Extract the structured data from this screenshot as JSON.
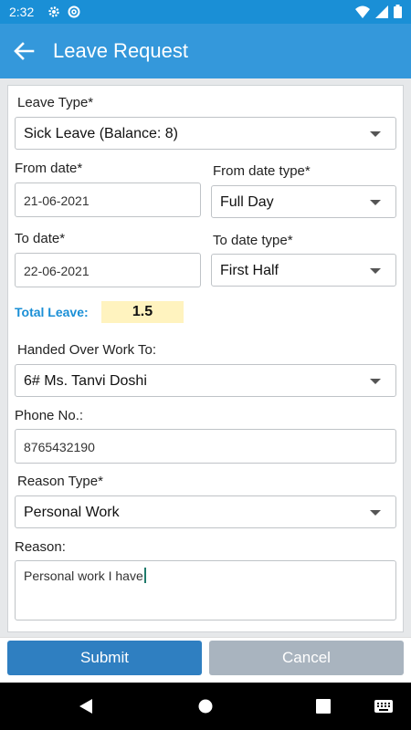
{
  "status_bar": {
    "time": "2:32"
  },
  "app_bar": {
    "title": "Leave Request"
  },
  "form": {
    "leave_type": {
      "label": "Leave Type*",
      "value": "Sick Leave (Balance: 8)"
    },
    "from_date": {
      "label": "From date*",
      "value": "21-06-2021"
    },
    "from_date_type": {
      "label": "From date type*",
      "value": "Full Day"
    },
    "to_date": {
      "label": "To date*",
      "value": "22-06-2021"
    },
    "to_date_type": {
      "label": "To date type*",
      "value": "First Half"
    },
    "total_leave": {
      "label": "Total Leave:",
      "value": "1.5"
    },
    "handed_over": {
      "label": "Handed Over Work To:",
      "value": "6# Ms. Tanvi Doshi"
    },
    "phone": {
      "label": "Phone No.:",
      "value": "8765432190"
    },
    "reason_type": {
      "label": "Reason Type*",
      "value": "Personal Work"
    },
    "reason": {
      "label": "Reason:",
      "value": "Personal work I have"
    }
  },
  "actions": {
    "submit": "Submit",
    "cancel": "Cancel"
  },
  "colors": {
    "primary": "#3498db",
    "status_bar": "#1a8fd6",
    "accent_text": "#1a8fd6",
    "highlight": "#fff3bf",
    "submit": "#2f7fc1",
    "cancel": "#a9b4bf"
  }
}
